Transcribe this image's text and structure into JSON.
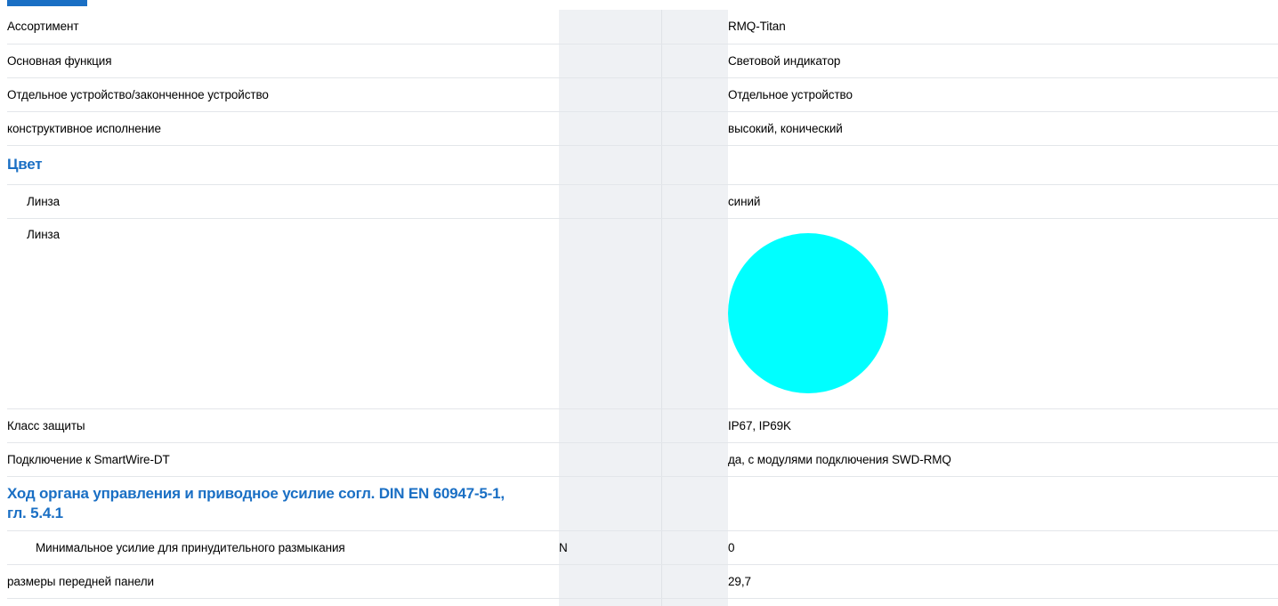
{
  "rows": [
    {
      "label": "Ассортимент",
      "unit": "",
      "value": "RMQ-Titan"
    },
    {
      "label": "Основная функция",
      "unit": "",
      "value": "Световой индикатор"
    },
    {
      "label": "Отдельное устройство/законченное устройство",
      "unit": "",
      "value": "Отдельное устройство"
    },
    {
      "label": "конструктивное исполнение",
      "unit": "",
      "value": "высокий, конический"
    },
    {
      "label": "Цвет"
    },
    {
      "label": "Линза",
      "unit": "",
      "value": "синий"
    },
    {
      "label": "Линза",
      "swatch_color": "#00ffff"
    },
    {
      "label": "Класс защиты",
      "unit": "",
      "value": "IP67, IP69K"
    },
    {
      "label": "Подключение к SmartWire-DT",
      "unit": "",
      "value": "да, с модулями подключения SWD-RMQ"
    },
    {
      "label": "Ход органа управления и приводное усилие согл. DIN EN 60947-5-1, гл. 5.4.1"
    },
    {
      "label": "Минимальное усилие для принудительного размыкания",
      "unit": "N",
      "value": "0"
    },
    {
      "label": "размеры передней панели",
      "unit": "",
      "value": "29,7"
    }
  ]
}
